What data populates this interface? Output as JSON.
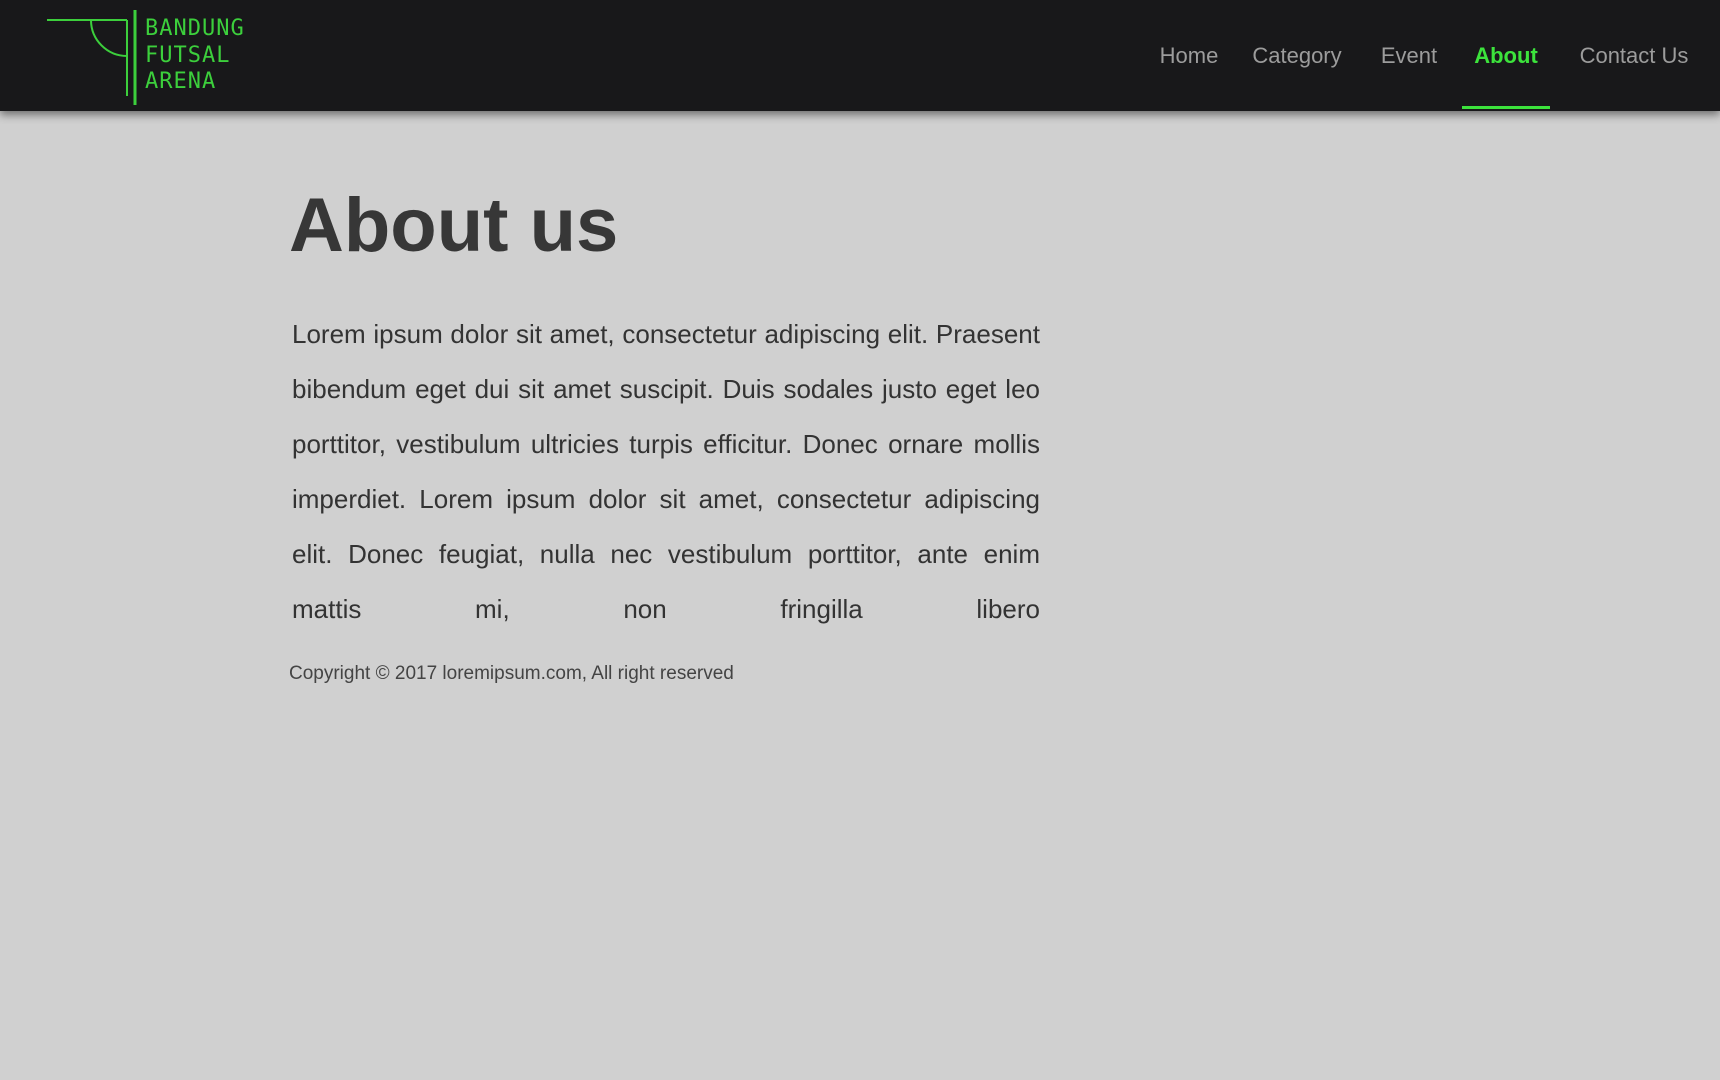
{
  "brand": {
    "logo_lines": [
      "BANDUNG",
      "FUTSAL",
      "ARENA"
    ],
    "icon": "futsal-goal-corner-icon",
    "color": "#3ccf3c"
  },
  "nav": {
    "items": [
      {
        "label": "Home",
        "active": false
      },
      {
        "label": "Category",
        "active": false
      },
      {
        "label": "Event",
        "active": false
      },
      {
        "label": "About",
        "active": true
      },
      {
        "label": "Contact Us",
        "active": false
      }
    ],
    "active_color": "#3ce33c",
    "inactive_color": "#9c9c9c"
  },
  "main": {
    "title": "About us",
    "body": "Lorem ipsum dolor sit amet, consectetur adipiscing elit. Praesent bibendum eget dui sit amet suscipit. Duis sodales justo eget leo porttitor, vestibulum ultricies turpis efficitur. Donec ornare mollis imperdiet. Lorem ipsum dolor sit amet, consectetur adipiscing elit. Donec feugiat, nulla nec vestibulum porttitor, ante enim mattis mi, non fringilla libero"
  },
  "footer": {
    "copyright": "Copyright © 2017 loremipsum.com, All right reserved"
  },
  "colors": {
    "navbar_bg": "#18181a",
    "page_bg": "#d0d0d0",
    "accent": "#3ce33c"
  }
}
